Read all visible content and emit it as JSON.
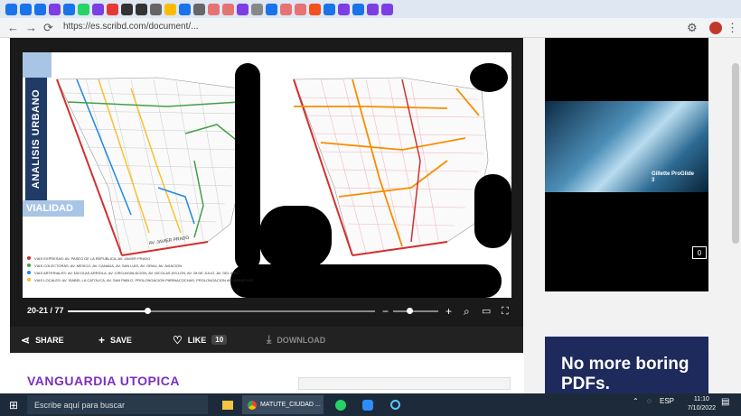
{
  "browser": {
    "url": "https://es.scribd.com/document/...",
    "bookmark_colors": [
      "#1a73e8",
      "#1a73e8",
      "#1a73e8",
      "#7b3fe4",
      "#1a73e8",
      "#25d366",
      "#7b3fe4",
      "#e53935",
      "#333333",
      "#333333",
      "#666666",
      "#fbbc05",
      "#1a73e8",
      "#666666",
      "#e57373",
      "#e57373",
      "#7b3fe4",
      "#888888",
      "#1a73e8",
      "#e57373",
      "#e57373",
      "#f4511e",
      "#1a73e8",
      "#7b3fe4",
      "#1a73e8",
      "#7b3fe4",
      "#7b3fe4"
    ]
  },
  "slide": {
    "vertical_title": "ANALISIS URBANO",
    "section_label": "VIALIDAD",
    "street_label": "AV. JAVIER PRADO",
    "legend": [
      {
        "color": "#d32f2f",
        "text": "VIAS EXPRESAS: AV. PASEO DE LA REPUBLICA, AV. JAVIER PRADO"
      },
      {
        "color": "#43a047",
        "text": "VIAS COLECTORAS: AV. MEXICO, AV. CANADA, AV. SAN LUIS, AV. GRAU, AV. AVIACION"
      },
      {
        "color": "#1e88e5",
        "text": "VIAS ARTERIALES: AV. NICOLAS ARRIOLA, AV. CIRCUNVALACION, AV. NICOLAS AYLLON, AV. 28 DE JULIO, AV. DEL AIRE..."
      },
      {
        "color": "#fbc02d",
        "text": "VIAS LOCALES: AV. ISABEL LA CATOLICA, AV. SAN PABLO, PROLONGACION PARINACOCHAS, PROLONGACION ANDAHUAYLAS"
      }
    ]
  },
  "viewer": {
    "page_counter": "20-21 / 77",
    "progress": 0.26,
    "zoom_level": 0.3
  },
  "actions": {
    "share": "SHARE",
    "save": "SAVE",
    "like": "LIKE",
    "like_count": "10",
    "download": "DOWNLOAD"
  },
  "ad": {
    "counter": "0",
    "video_caption": "Gillette ProGlide 3",
    "promo_text": "No more boring PDFs."
  },
  "document": {
    "title": "VANGUARDIA UTOPICA"
  },
  "taskbar": {
    "search_placeholder": "Escribe aquí para buscar",
    "chrome_tab": "MATUTE_CIUDAD ...",
    "time": "11:10",
    "date": "7/10/2022",
    "language": "ESP"
  }
}
